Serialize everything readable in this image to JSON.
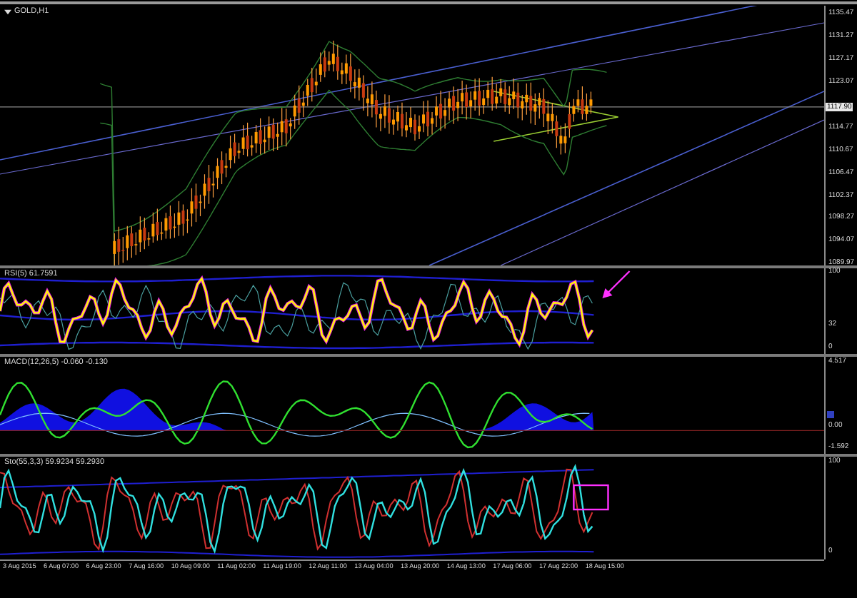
{
  "chart": {
    "title": "GOLD,H1",
    "current_price": "1117.90",
    "price_axis": [
      "1135.47",
      "1131.27",
      "1127.17",
      "1123.07",
      "1114.77",
      "1110.67",
      "1106.47",
      "1102.37",
      "1098.27",
      "1094.07",
      "1089.97"
    ]
  },
  "indicators": [
    {
      "kind": "rsi",
      "label": "RSI(5) 61.7591",
      "axis": [
        "100",
        "32",
        "0"
      ]
    },
    {
      "kind": "macd",
      "label": "MACD(12,26,5) -0.060 -0.130",
      "axis": [
        "4.517",
        "0.00",
        "-1.592"
      ]
    },
    {
      "kind": "stochastic",
      "label": "Sto(55,3,3) 59.9234 59.2930",
      "axis": [
        "100",
        "0"
      ]
    }
  ],
  "time_axis": [
    "3 Aug 2015",
    "6 Aug 07:00",
    "6 Aug 23:00",
    "7 Aug 16:00",
    "10 Aug 09:00",
    "11 Aug 02:00",
    "11 Aug 19:00",
    "12 Aug 11:00",
    "13 Aug 04:00",
    "13 Aug 20:00",
    "14 Aug 13:00",
    "17 Aug 06:00",
    "17 Aug 22:00",
    "18 Aug 15:00"
  ]
}
